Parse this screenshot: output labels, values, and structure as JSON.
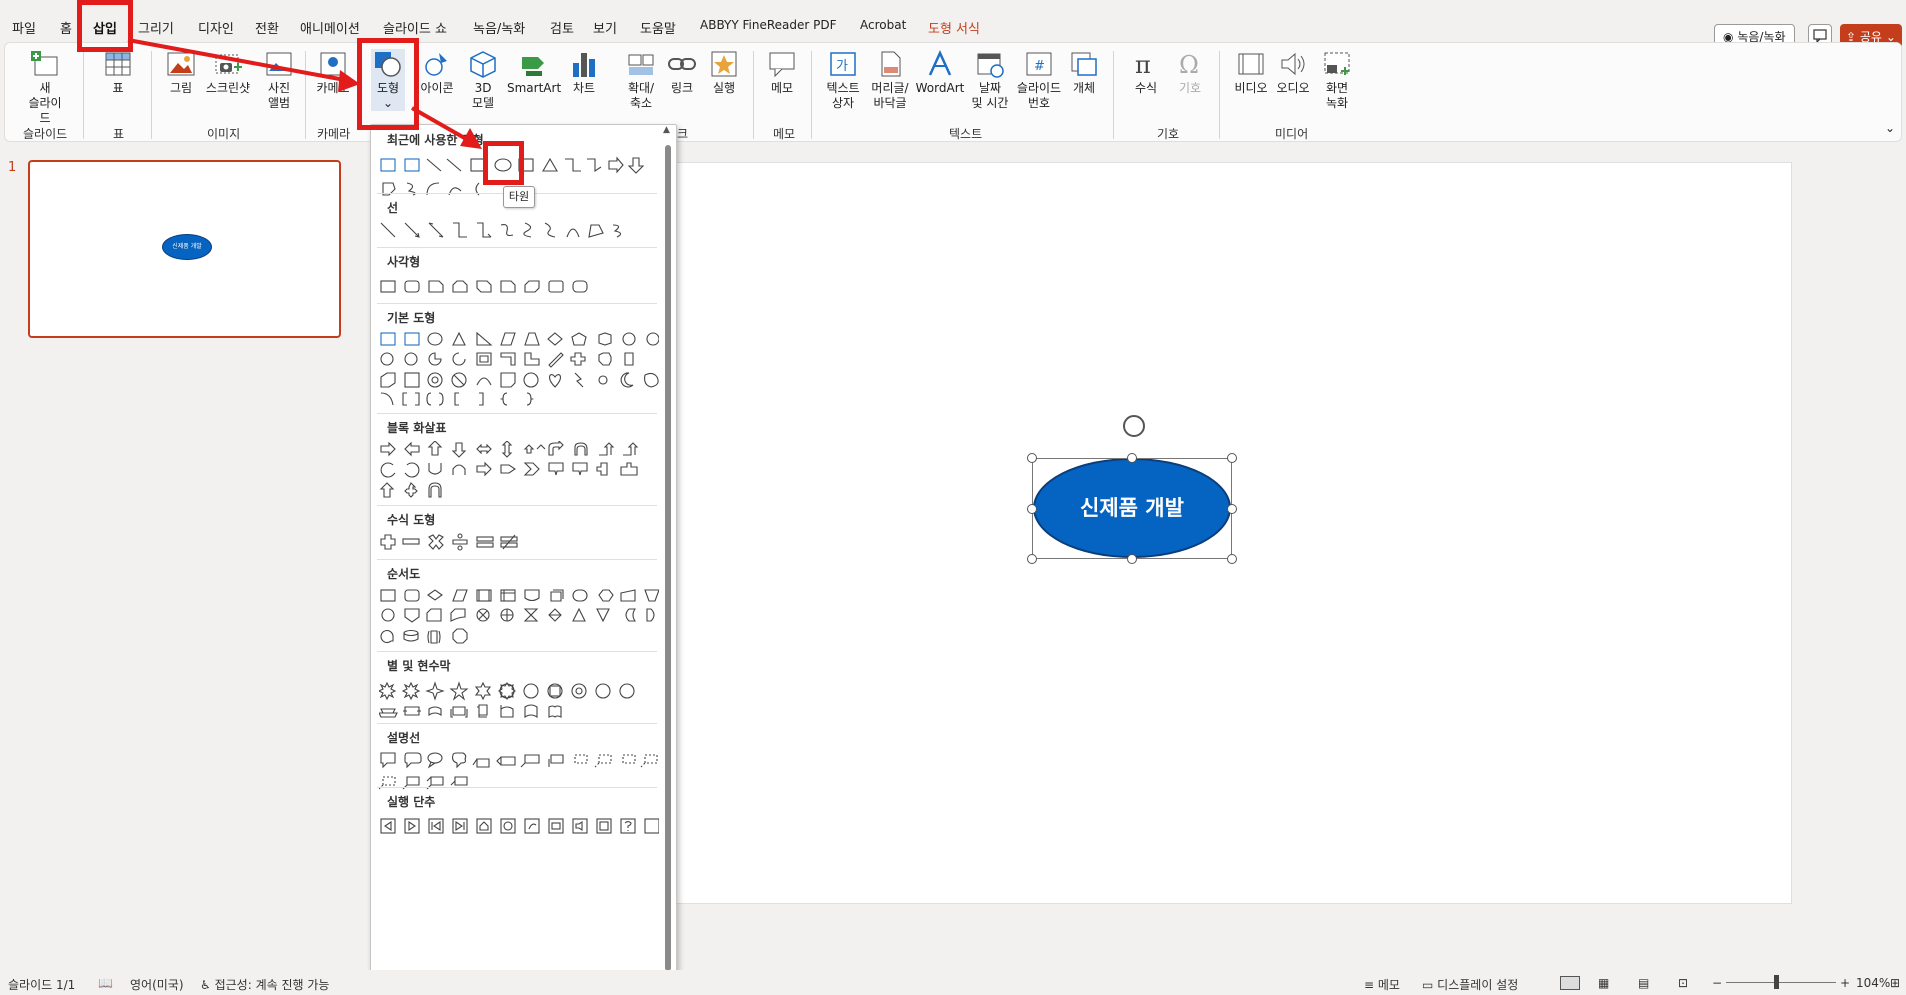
{
  "menu": {
    "tabs": [
      "파일",
      "홈",
      "삽입",
      "그리기",
      "디자인",
      "전환",
      "애니메이션",
      "슬라이드 쇼",
      "녹음/녹화",
      "검토",
      "보기",
      "도움말",
      "ABBYY FineReader PDF",
      "Acrobat",
      "도형 서식"
    ],
    "active_tab": "삽입",
    "record_button": "녹음/녹화",
    "share_button": "공유"
  },
  "ribbon": {
    "buttons": {
      "new_slide": "새\n슬라이드",
      "table": "표",
      "picture": "그림",
      "screenshot": "스크린샷",
      "photo_album": "사진\n앨범",
      "cameo": "카메오",
      "shapes": "도형",
      "icons": "아이콘",
      "model3d": "3D\n모델",
      "smartart": "SmartArt",
      "chart": "차트",
      "zoom": "확대/\n축소",
      "link": "링크",
      "action": "실행",
      "comment": "메모",
      "textbox": "텍스트\n상자",
      "header_footer": "머리글/\n바닥글",
      "wordart": "WordArt",
      "datetime": "날짜\n및 시간",
      "slide_number": "슬라이드\n번호",
      "object": "개체",
      "equation": "수식",
      "symbol": "기호",
      "video": "비디오",
      "audio": "오디오",
      "screen_recording": "화면\n녹화"
    },
    "groups": {
      "slides": "슬라이드",
      "tables": "표",
      "images": "이미지",
      "camera": "카메라",
      "links": "크",
      "comments": "메모",
      "text": "텍스트",
      "symbols": "기호",
      "media": "미디어"
    }
  },
  "thumbnail": {
    "number": "1",
    "shape_text": "신제품 개발"
  },
  "slide": {
    "shape_text": "신제품 개발",
    "shape_fill": "#0563c1"
  },
  "gallery": {
    "sections": [
      "최근에 사용한 도형",
      "선",
      "사각형",
      "기본 도형",
      "블록 화살표",
      "수식 도형",
      "순서도",
      "별 및 현수막",
      "설명선",
      "실행 단추"
    ],
    "tooltip": "타원"
  },
  "status": {
    "slide_count": "슬라이드 1/1",
    "language": "영어(미국)",
    "accessibility": "접근성: 계속 진행 가능",
    "notes": "메모",
    "display_settings": "디스플레이 설정",
    "zoom": "104%"
  }
}
